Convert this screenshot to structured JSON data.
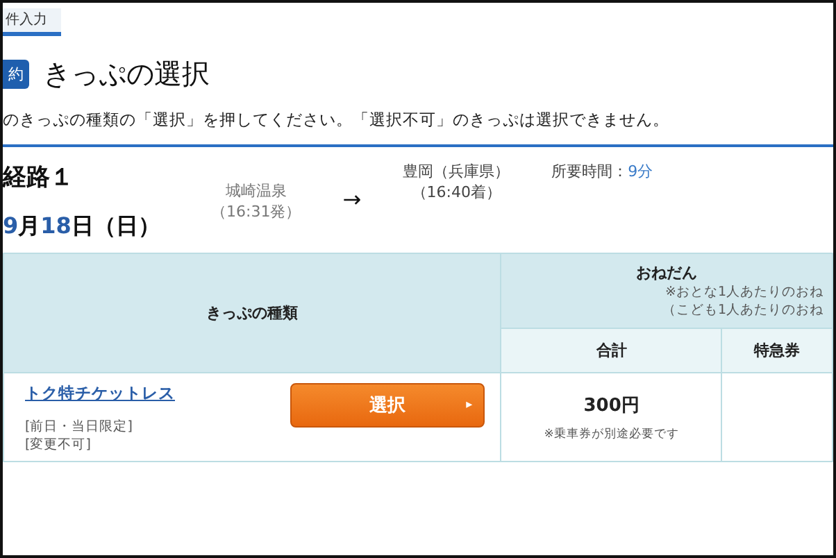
{
  "top_tab": {
    "label": "件入力"
  },
  "heading": {
    "badge": "約",
    "title": "きっぷの選択"
  },
  "instruction": "のきっぷの種類の「選択」を押してください。「選択不可」のきっぷは選択できません。",
  "route": {
    "title": "経路１",
    "date_parts": [
      {
        "text": "9",
        "kind": "number"
      },
      {
        "text": "月",
        "kind": "unit"
      },
      {
        "text": "18",
        "kind": "number"
      },
      {
        "text": "日（日）",
        "kind": "unit"
      }
    ],
    "from_station": "城崎温泉",
    "from_time": "（16:31発）",
    "arrow": "→",
    "to_station": "豊岡（兵庫県）",
    "to_time": "（16:40着）",
    "duration_label": "所要時間：",
    "duration_value": "9分"
  },
  "table": {
    "type_header": "きっぷの種類",
    "price_header": "おねだん",
    "price_note_1": "※おとな1人あたりのおね",
    "price_note_2": "（こども1人あたりのおね",
    "columns": [
      "合計",
      "特急券"
    ],
    "rows": [
      {
        "name": "トク特チケットレス",
        "conditions": [
          "[前日・当日限定]",
          "[変更不可]"
        ],
        "button": "選択",
        "button_arrow": "▸",
        "total": "300円",
        "total_note": "※乗車券が別途必要です",
        "express": ""
      }
    ]
  }
}
